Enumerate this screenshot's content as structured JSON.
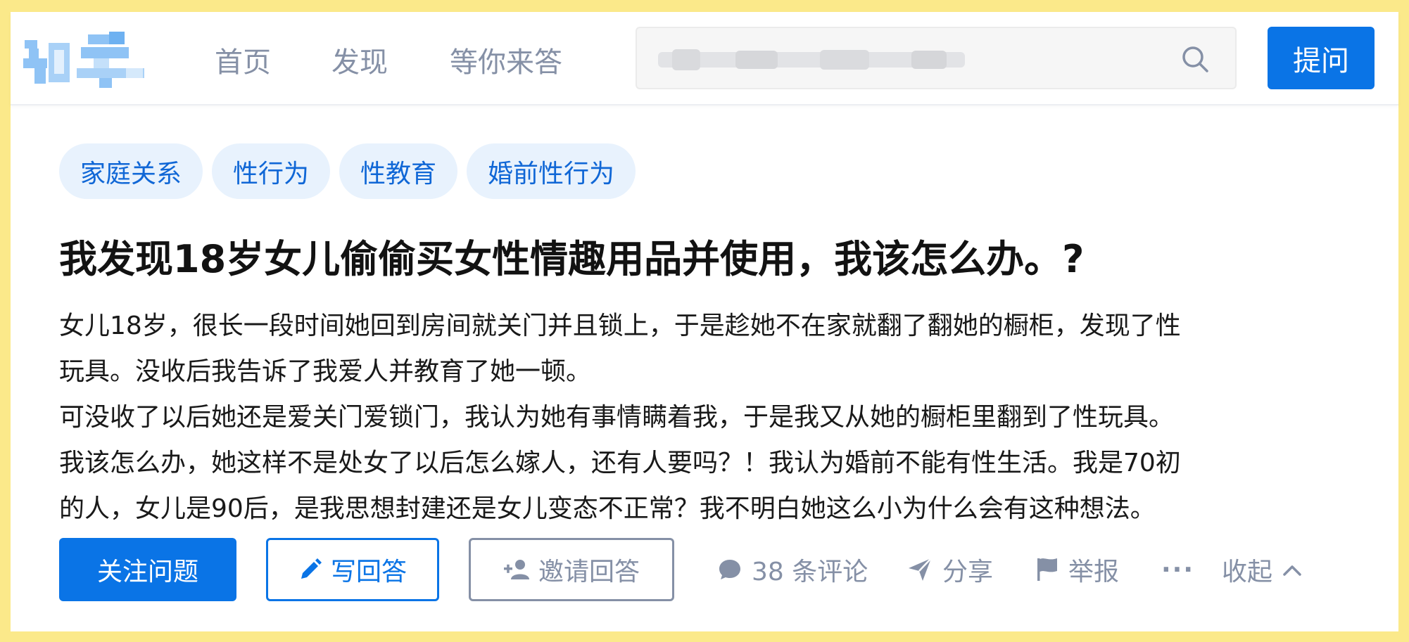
{
  "header": {
    "logo_text": "知乎",
    "nav": [
      "首页",
      "发现",
      "等你来答"
    ],
    "search": {
      "value": "",
      "placeholder": ""
    },
    "ask_label": "提问"
  },
  "question": {
    "tags": [
      "家庭关系",
      "性行为",
      "性教育",
      "婚前性行为"
    ],
    "title": "我发现18岁女儿偷偷买女性情趣用品并使用，我该怎么办。?",
    "lines": [
      "女儿18岁，很长一段时间她回到房间就关门并且锁上，于是趁她不在家就翻了翻她的橱柜，发现了性",
      "玩具。没收后我告诉了我爱人并教育了她一顿。",
      "可没收了以后她还是爱关门爱锁门，我认为她有事情瞒着我，于是我又从她的橱柜里翻到了性玩具。",
      "我该怎么办，她这样不是处女了以后怎么嫁人，还有人要吗？！我认为婚前不能有性生活。我是70初",
      "的人，女儿是90后，是我思想封建还是女儿变态不正常？我不明白她这么小为什么会有这种想法。"
    ]
  },
  "actions": {
    "follow": "关注问题",
    "write": "写回答",
    "invite": "邀请回答",
    "comments": "38 条评论",
    "share": "分享",
    "report": "举报",
    "more": "···",
    "collapse": "收起"
  },
  "colors": {
    "accent": "#0a74e6",
    "muted": "#8590a6",
    "tag_bg": "#e8f2fd",
    "border": "#fbe98a"
  }
}
